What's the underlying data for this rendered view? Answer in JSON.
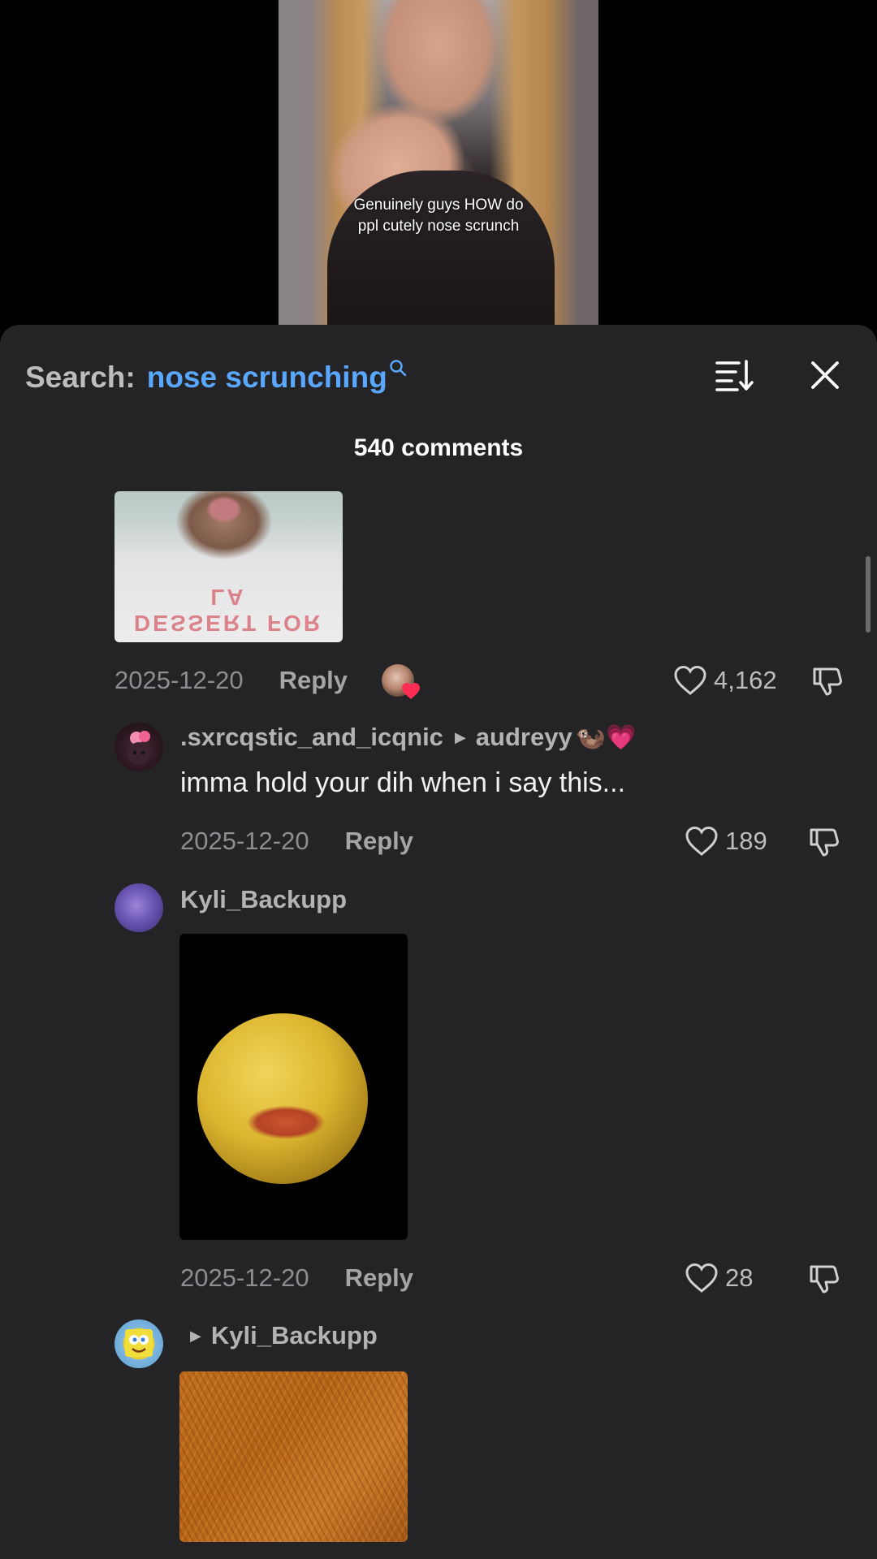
{
  "video": {
    "caption": "Genuinely guys HOW do\nppl cutely nose scrunch"
  },
  "header": {
    "search_label": "Search:",
    "search_query": "nose scrunching",
    "comments_count": "540 comments"
  },
  "icons": {
    "search": "search-icon",
    "sort": "sort-icon",
    "close": "close-icon",
    "like": "heart-icon",
    "dislike": "thumbs-down-icon"
  },
  "colors": {
    "accent": "#5aa7ff",
    "sheet_bg": "#242426",
    "liked_heart": "#ff2d55"
  },
  "comments": [
    {
      "date": "2025-12-20",
      "reply_label": "Reply",
      "likes": "4,162",
      "attachment_text": "DESSERT FOR LA"
    },
    {
      "username": ".sxrcqstic_and_icqnic",
      "reply_to": "audreyy",
      "reply_to_emoji": "🦦💗",
      "text": "imma hold your dih when i say this...",
      "date": "2025-12-20",
      "reply_label": "Reply",
      "likes": "189"
    },
    {
      "username": "Kyli_Backupp",
      "date": "2025-12-20",
      "reply_label": "Reply",
      "likes": "28"
    },
    {
      "reply_to": "Kyli_Backupp"
    }
  ]
}
